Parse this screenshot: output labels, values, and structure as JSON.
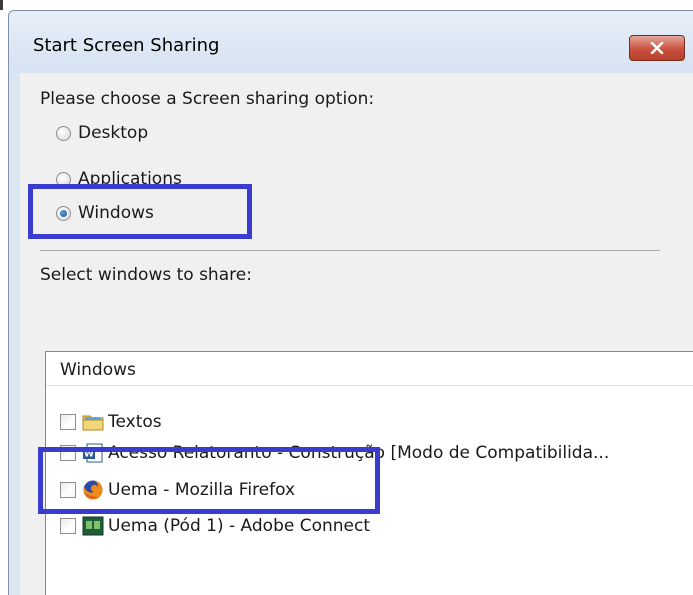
{
  "window": {
    "title": "Start Screen Sharing"
  },
  "dialog": {
    "prompt": "Please choose a Screen sharing option:",
    "options": [
      {
        "label": "Desktop",
        "checked": false
      },
      {
        "label": "Applications",
        "checked": false
      },
      {
        "label": "Windows",
        "checked": true
      }
    ],
    "select_label": "Select windows to share:"
  },
  "window_list": {
    "header": "Windows",
    "items": [
      {
        "label": "Textos",
        "icon": "folder-icon",
        "checked": false
      },
      {
        "label": "Acesso Relatoranto - Construção [Modo de Compatibilida...",
        "icon": "word-document-icon",
        "checked": false
      },
      {
        "label": "Uema - Mozilla Firefox",
        "icon": "firefox-icon",
        "checked": false
      },
      {
        "label": "Uema (Pód 1) - Adobe Connect",
        "icon": "adobe-connect-icon",
        "checked": false
      }
    ]
  },
  "colors": {
    "highlight": "#3a3ccf",
    "close_button": "#c8513f"
  }
}
